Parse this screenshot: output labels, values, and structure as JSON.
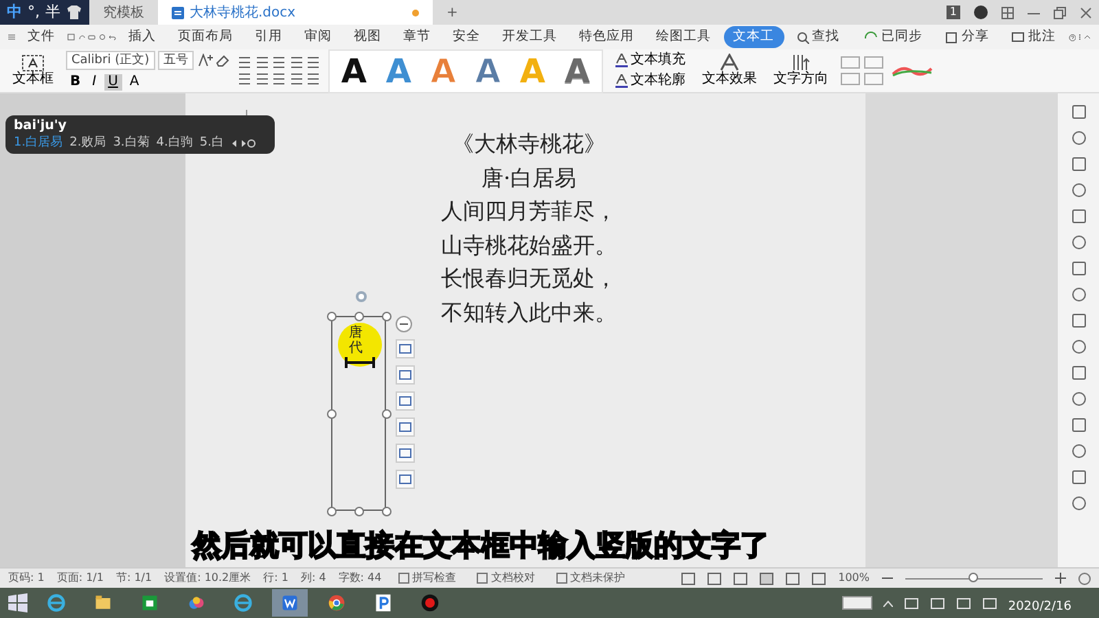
{
  "title_bar": {
    "ime": [
      "中",
      "°,",
      "半"
    ],
    "tabs": [
      {
        "label": "究模板",
        "selected": false
      },
      {
        "label": "大林寺桃花.docx",
        "selected": true
      }
    ],
    "new_tab": "+",
    "account_badge": "1"
  },
  "menu_bar": {
    "file_menu": "文件",
    "items": [
      {
        "label": "插入",
        "selected": false
      },
      {
        "label": "页面布局",
        "selected": false
      },
      {
        "label": "引用",
        "selected": false
      },
      {
        "label": "审阅",
        "selected": false
      },
      {
        "label": "视图",
        "selected": false
      },
      {
        "label": "章节",
        "selected": false
      },
      {
        "label": "安全",
        "selected": false
      },
      {
        "label": "开发工具",
        "selected": false
      },
      {
        "label": "特色应用",
        "selected": false
      },
      {
        "label": "绘图工具",
        "selected": false
      },
      {
        "label": "文本工",
        "selected": true
      }
    ],
    "search": "查找",
    "sync": "已同步",
    "share": "分享",
    "comment": "批注"
  },
  "ribbon": {
    "text_box": "文本框",
    "font": "Calibri (正文)",
    "size": "五号",
    "format_buttons": [
      "B",
      "I",
      "U",
      "A"
    ],
    "art_styles": [
      {
        "letter": "A",
        "kind": "solid",
        "color": "#111111"
      },
      {
        "letter": "A",
        "kind": "solid",
        "color": "#3f8fd2"
      },
      {
        "letter": "A",
        "kind": "outline",
        "color": "#e8803a"
      },
      {
        "letter": "A",
        "kind": "outline",
        "color": "#5b7da6"
      },
      {
        "letter": "A",
        "kind": "solid",
        "color": "#f2b010"
      },
      {
        "letter": "A",
        "kind": "gradient",
        "color": "#6b6b6b"
      }
    ],
    "text_fill": "文本填充",
    "text_outline": "文本轮廓",
    "text_effect": "文本效果",
    "text_direction": "文字方向"
  },
  "ime_popup": {
    "pinyin": "bai'ju'y",
    "candidates": [
      {
        "label": "1.白居易",
        "selected": true
      },
      {
        "label": "2.败局",
        "selected": false
      },
      {
        "label": "3.白菊",
        "selected": false
      },
      {
        "label": "4.白驹",
        "selected": false
      },
      {
        "label": "5.白",
        "selected": false
      }
    ]
  },
  "document": {
    "lines": [
      "《大林寺桃花》",
      "唐·白居易",
      "人间四月芳菲尽，",
      "山寺桃花始盛开。",
      "长恨春归无觅处，",
      "不知转入此中来。"
    ],
    "text_box": {
      "text": "唐代"
    }
  },
  "subtitle": "然后就可以直接在文本框中输入竖版的文字了",
  "status_bar": {
    "fields": [
      "页码: 1",
      "页面: 1/1",
      "节: 1/1",
      "设置值: 10.2厘米",
      "行: 1",
      "列: 4",
      "字数: 44"
    ],
    "checks": [
      "拼写检查",
      "文档校对",
      "文档未保护"
    ],
    "zoom": "100%",
    "zoom_slider": {
      "level": 0.5
    }
  },
  "taskbar": {
    "apps": [
      {
        "kind": "ie",
        "selected": false
      },
      {
        "kind": "folder",
        "selected": false
      },
      {
        "kind": "store",
        "selected": false
      },
      {
        "kind": "cloud",
        "selected": false
      },
      {
        "kind": "ie",
        "selected": false
      },
      {
        "kind": "wps",
        "selected": true
      },
      {
        "kind": "chrome",
        "selected": false
      },
      {
        "kind": "p",
        "selected": false
      },
      {
        "kind": "record",
        "selected": false
      }
    ],
    "date": "2020/2/16"
  }
}
